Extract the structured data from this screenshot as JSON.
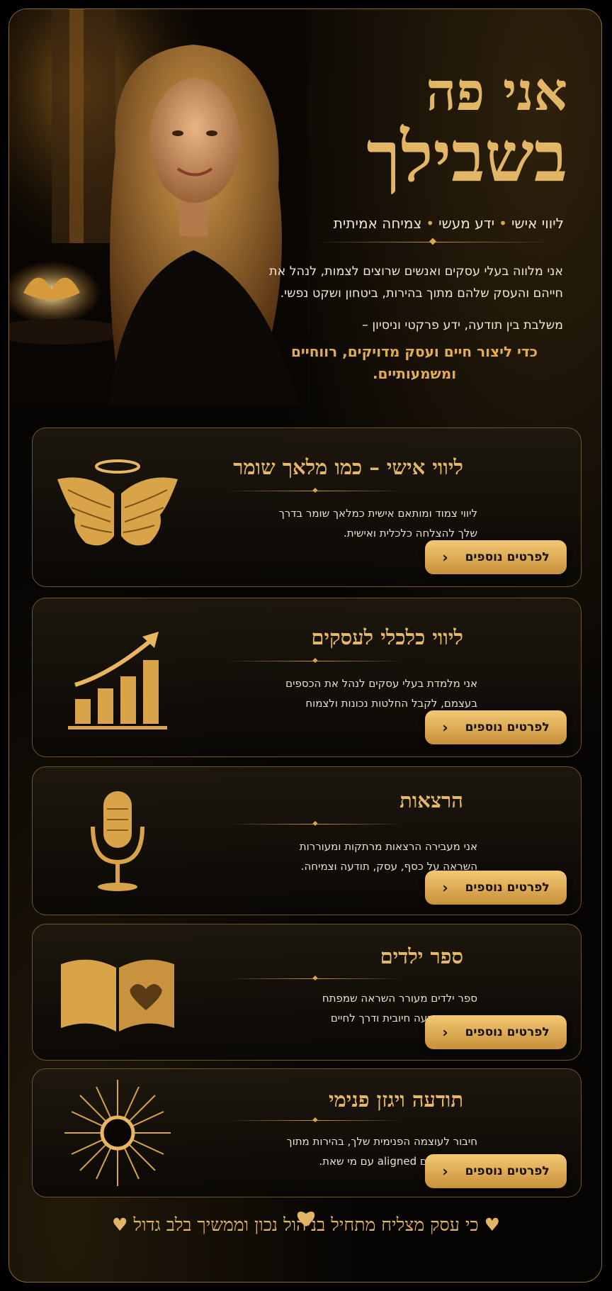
{
  "hero": {
    "title_line1": "אני פה",
    "title_line2": "בשבילך",
    "tagline": [
      "ליווי אישי",
      "ידע מעשי",
      "צמיחה אמיתית"
    ],
    "intro": "אני מלווה בעלי עסקים ואנשים שרוצים לצמות, לנהל את חייהם והעסק שלהם מתוך בהירות, ביטחון ושקט נפשי.",
    "mix": "משלבת בין תודעה, ידע פרקטי וניסיון –",
    "highlight": "כדי ליצור חיים ועסק מדויקים, רווחיים ומשמעותיים."
  },
  "cards": [
    {
      "title": "ליווי אישי – כמו מלאך שומר",
      "desc": "ליווי צמוד ומותאם אישית כמלאך שומר בדרך שלך להצלחה כלכלית ואישית.",
      "button": "לפרטים נוספים",
      "icon": "angel-wings-icon"
    },
    {
      "title": "ליווי כלכלי לעסקים",
      "desc": "אני מלמדת בעלי עסקים לנהל את הכספים בעצמם, לקבל החלטות נכונות ולצמוח בביטחון.",
      "button": "לפרטים נוספים",
      "icon": "growth-chart-icon"
    },
    {
      "title": "הרצאות",
      "desc": "אני מעבירה הרצאות מרתקות ומעוררות השראה על כסף, עסק, תודעה וצמיחה.",
      "button": "לפרטים נוספים",
      "icon": "microphone-icon"
    },
    {
      "title": "ספר ילדים",
      "desc": "ספר ילדים מעורר השראה שמפתח ערכים, תודעה חיובית ודרך לחיים מאושרים.",
      "button": "לפרטים נוספים",
      "icon": "open-book-icon"
    },
    {
      "title": "תודעה ויגזן פנימי",
      "desc": "חיבור לעוצמה הפנימית שלך, בהירות מתוך מודעות וחיים aligned עם מי שאת.",
      "button": "לפרטים נוספים",
      "icon": "sun-icon"
    }
  ],
  "footer": {
    "text": "כי עסק מצליח מתחיל בניהול נכון וממשיך בלב גדול"
  },
  "colors": {
    "gold": "#e3b665",
    "button": "#d9a54e",
    "background": "#050403"
  }
}
